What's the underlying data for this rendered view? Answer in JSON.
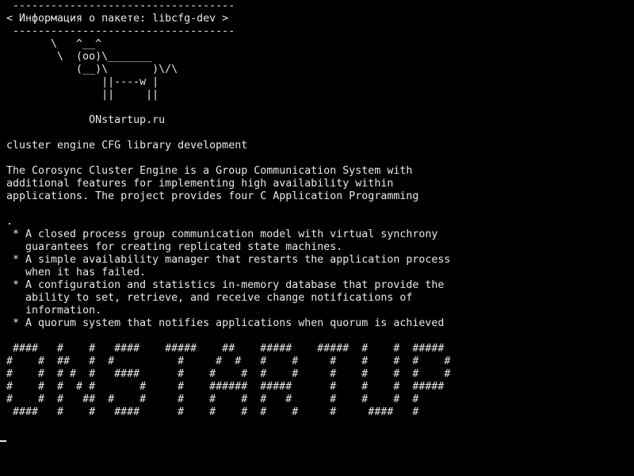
{
  "terminal": {
    "lines": [
      " -----------------------------------",
      "< Информация о пакете: libcfg-dev >",
      " -----------------------------------",
      "       \\   ^__^",
      "        \\  (oo)\\_______",
      "           (__)\\       )\\/\\",
      "               ||----w |",
      "               ||     ||",
      "",
      "             ONstartup.ru",
      "",
      "cluster engine CFG library development",
      "",
      "The Corosync Cluster Engine is a Group Communication System with",
      "additional features for implementing high availability within",
      "applications. The project provides four C Application Programming",
      "",
      ".",
      " * A closed process group communication model with virtual synchrony",
      "   guarantees for creating replicated state machines.",
      " * A simple availability manager that restarts the application process",
      "   when it has failed.",
      " * A configuration and statistics in-memory database that provide the",
      "   ability to set, retrieve, and receive change notifications of",
      "   information.",
      " * A quorum system that notifies applications when quorum is achieved",
      "",
      " ####   #    #   ####    #####    ##    #####    #####  #    #  #####",
      "#    #  ##   #  #          #     #  #   #    #     #    #    #  #    #",
      "#    #  # #  #   ####      #    #    #  #    #     #    #    #  #    #",
      "#    #  #  # #       #     #    ######  #####      #    #    #  #####",
      "#    #  #   ##  #    #     #    #    #  #   #      #    #    #  #",
      " ####   #    #   ####      #    #    #  #    #     #     ####   #"
    ]
  }
}
